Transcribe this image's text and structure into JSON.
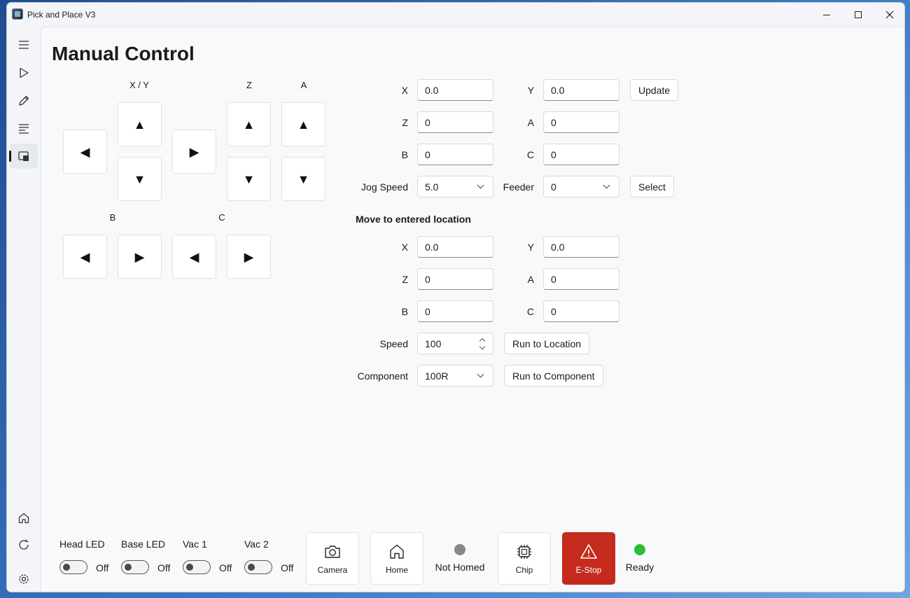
{
  "window": {
    "title": "Pick and Place V3"
  },
  "nav": {
    "items": [
      "menu-icon",
      "play-icon",
      "pencil-icon",
      "list-icon",
      "machine-icon",
      "home-icon",
      "refresh-icon",
      "gear-icon"
    ]
  },
  "page": {
    "title": "Manual Control"
  },
  "jog": {
    "xy_label": "X / Y",
    "z_label": "Z",
    "a_label": "A",
    "b_label": "B",
    "c_label": "C",
    "glyph_up": "▲",
    "glyph_down": "▼",
    "glyph_left": "◀",
    "glyph_right": "▶"
  },
  "current": {
    "x_label": "X",
    "x_value": "0.0",
    "y_label": "Y",
    "y_value": "0.0",
    "z_label": "Z",
    "z_value": "0",
    "a_label": "A",
    "a_value": "0",
    "b_label": "B",
    "b_value": "0",
    "c_label": "C",
    "c_value": "0",
    "update_label": "Update",
    "jog_speed_label": "Jog Speed",
    "jog_speed_value": "5.0",
    "feeder_label": "Feeder",
    "feeder_value": "0",
    "select_label": "Select"
  },
  "move": {
    "section_title": "Move to entered location",
    "x_label": "X",
    "x_value": "0.0",
    "y_label": "Y",
    "y_value": "0.0",
    "z_label": "Z",
    "z_value": "0",
    "a_label": "A",
    "a_value": "0",
    "b_label": "B",
    "b_value": "0",
    "c_label": "C",
    "c_value": "0",
    "speed_label": "Speed",
    "speed_value": "100",
    "run_location_label": "Run to Location",
    "component_label": "Component",
    "component_value": "100R",
    "run_component_label": "Run to Component"
  },
  "bottom": {
    "head_led_label": "Head LED",
    "head_led_state": "Off",
    "base_led_label": "Base LED",
    "base_led_state": "Off",
    "vac1_label": "Vac 1",
    "vac1_state": "Off",
    "vac2_label": "Vac 2",
    "vac2_state": "Off",
    "camera_label": "Camera",
    "home_label": "Home",
    "homed_status": "Not Homed",
    "chip_label": "Chip",
    "estop_label": "E-Stop",
    "ready_status": "Ready"
  },
  "colors": {
    "estop": "#c42b1c",
    "ready_dot": "#2bbd3a",
    "homed_dot": "#888888"
  }
}
